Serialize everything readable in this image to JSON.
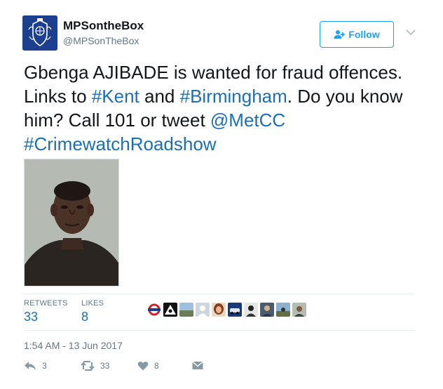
{
  "author": {
    "name": "MPSontheBox",
    "handle": "@MPSonTheBox"
  },
  "follow_label": "Follow",
  "tweet": {
    "seg1": "Gbenga AJIBADE is wanted for fraud offences. Links to ",
    "tag_kent": "#Kent",
    "seg2": " and ",
    "tag_birmingham": "#Birmingham",
    "seg3": ". Do you know him? Call 101 or tweet ",
    "mention": "@MetCC",
    "seg4": " ",
    "tag_crimewatch": "#CrimewatchRoadshow"
  },
  "stats": {
    "retweets_label": "RETWEETS",
    "retweets_value": "33",
    "likes_label": "LIKES",
    "likes_value": "8"
  },
  "timestamp": "1:54 AM - 13 Jun 2017",
  "actions": {
    "reply_count": "3",
    "retweet_count": "33",
    "like_count": "8"
  },
  "colors": {
    "link": "#1b6fb5",
    "accent": "#1da1f2",
    "muted": "#657786",
    "avatar_bg": "#1c3f8f"
  }
}
